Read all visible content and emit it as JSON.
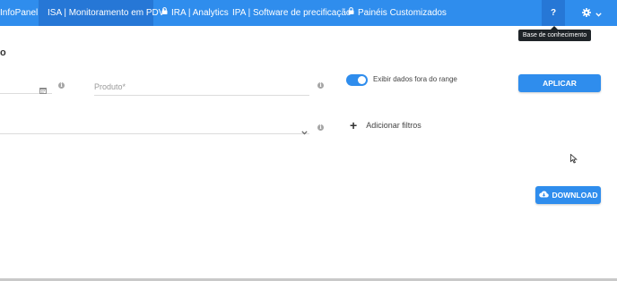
{
  "navbar": {
    "items": [
      {
        "label": "InfoPanel",
        "locked": false,
        "active": false
      },
      {
        "label": "ISA | Monitoramento em PDV",
        "locked": false,
        "active": true
      },
      {
        "label": "IRA | Analytics",
        "locked": true,
        "active": false
      },
      {
        "label": "IPA | Software de precificação",
        "locked": false,
        "active": false
      },
      {
        "label": "Painéis Customizados",
        "locked": true,
        "active": false
      }
    ],
    "help_label": "?",
    "tooltip": "Base de conhecimento"
  },
  "page": {
    "title_fragment": "o"
  },
  "filters": {
    "date_icon": "calendar-icon",
    "product_placeholder": "Produto*",
    "toggle_label": "Exibir dados fora do range",
    "toggle_on": true,
    "add_filter_label": "Adicionar filtros"
  },
  "actions": {
    "apply_label": "APLICAR",
    "download_label": "DOWNLOAD"
  },
  "colors": {
    "primary": "#2f8ded",
    "active_nav": "#2677d6",
    "tooltip_bg": "#1f2428"
  }
}
